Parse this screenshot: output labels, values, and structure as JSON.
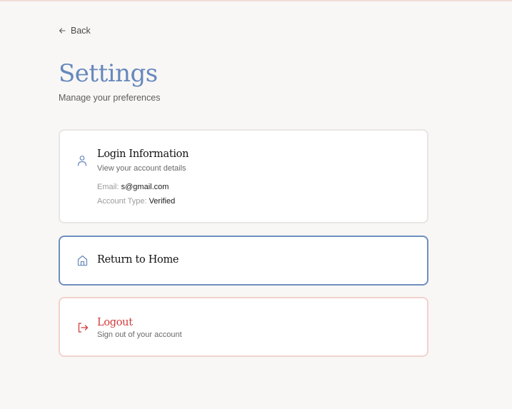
{
  "nav": {
    "back_label": "Back"
  },
  "header": {
    "title": "Settings",
    "subtitle": "Manage your preferences"
  },
  "login_card": {
    "title": "Login Information",
    "description": "View your account details",
    "email_label": "Email:",
    "email_value": "s@gmail.com",
    "account_type_label": "Account Type:",
    "account_type_value": "Verified",
    "icon": "user-icon"
  },
  "home_card": {
    "title": "Return to Home",
    "icon": "home-icon"
  },
  "logout_card": {
    "title": "Logout",
    "description": "Sign out of your account",
    "icon": "logout-icon"
  },
  "colors": {
    "accent": "#6788bd",
    "home_border": "#6f8fc0",
    "danger": "#d23b3b",
    "danger_border": "#f2d2cd",
    "background": "#f8f7f5"
  }
}
